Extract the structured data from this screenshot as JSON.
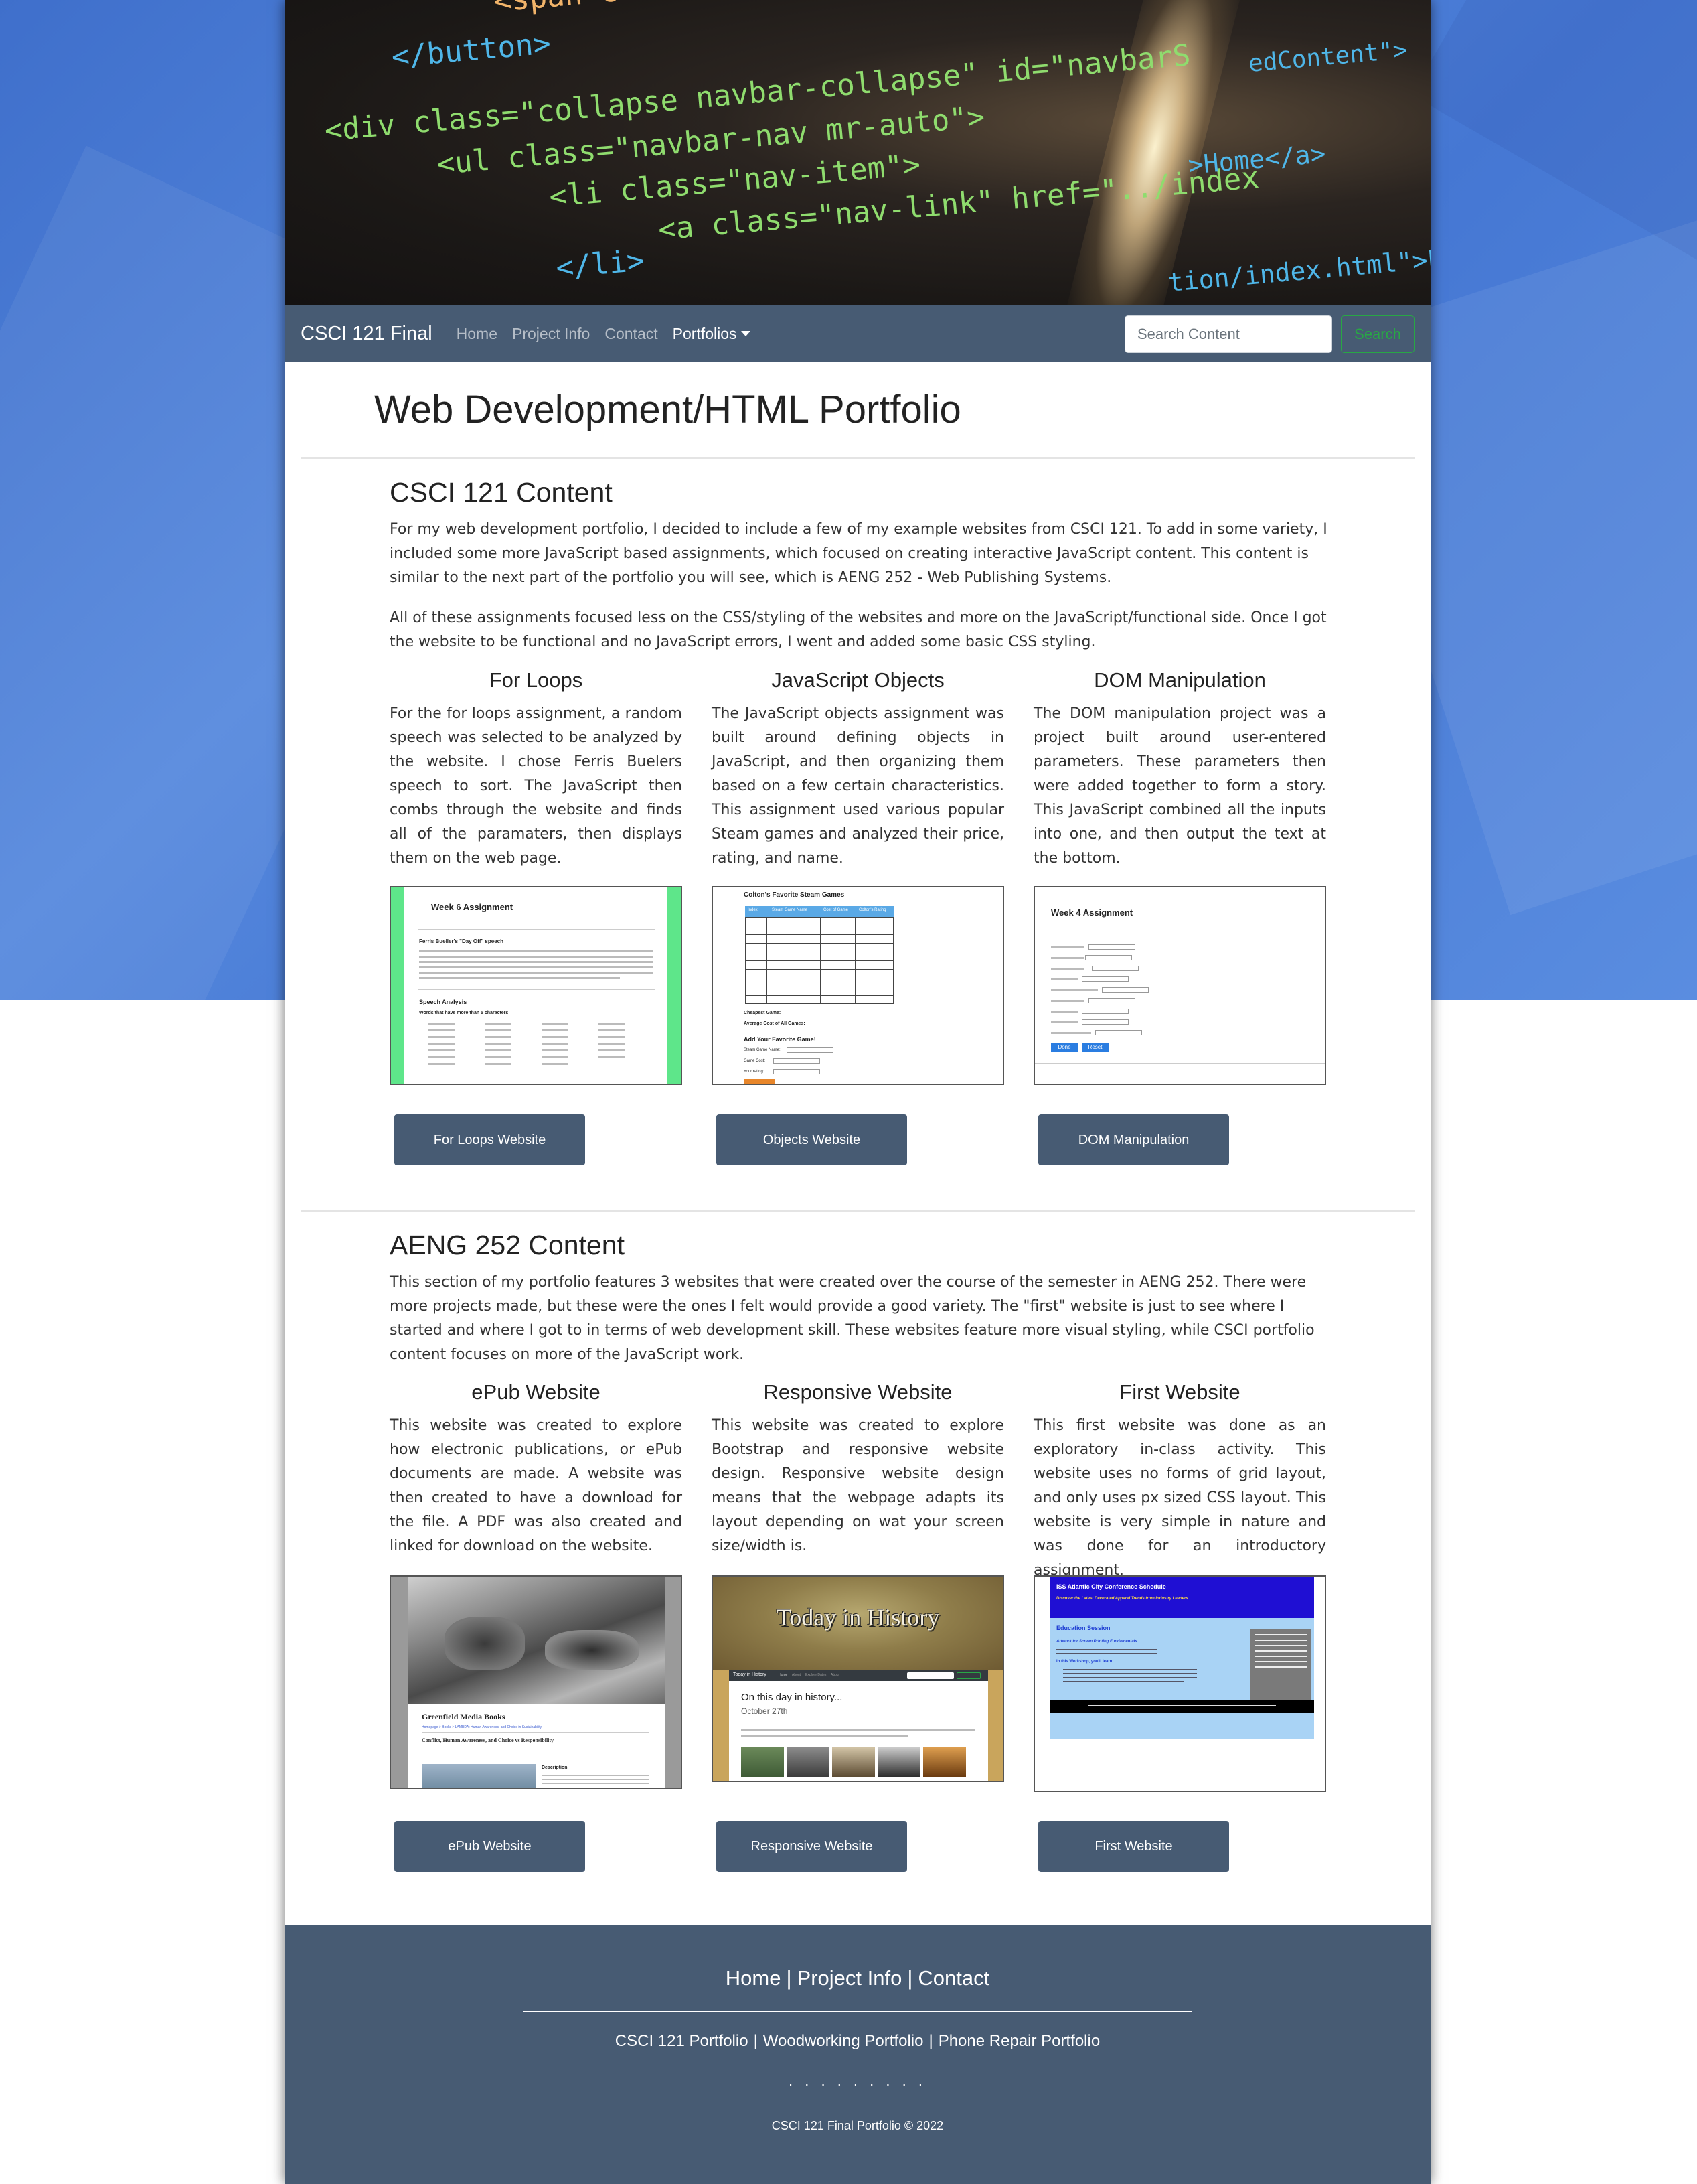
{
  "hero": {
    "code_lines": [
      "  <span class=\"navbar-toggl",
      "</button>",
      "<div class=\"collapse navbar-collapse\" id=\"navbarS",
      "  <ul class=\"navbar-nav mr-auto\">",
      "    <li class=\"nav-item\">",
      "      <a class=\"nav-link\" href=\"../index",
      "    </li>",
      "edContent\">",
      ">Home</a>",
      "tion/index.html\">Pr"
    ]
  },
  "navbar": {
    "brand": "CSCI 121 Final",
    "links": [
      "Home",
      "Project Info",
      "Contact"
    ],
    "dropdown": "Portfolios",
    "search_placeholder": "Search Content",
    "search_button": "Search"
  },
  "main": {
    "title": "Web Development/HTML Portfolio",
    "csci": {
      "heading": "CSCI 121 Content",
      "para1": "For my web development portfolio, I decided to include a few of my example websites from CSCI 121. To add in some variety, I included some more JavaScript based assignments, which focused on creating interactive JavaScript content. This content is similar to the next part of the portfolio you will see, which is AENG 252 - Web Publishing Systems.",
      "para2": "All of these assignments focused less on the CSS/styling of the websites and more on the JavaScript/functional side. Once I got the website to be functional and no JavaScript errors, I went and added some basic CSS styling.",
      "cards": [
        {
          "title": "For Loops",
          "text": "For the for loops assignment, a random speech was selected to be analyzed by the website. I chose Ferris Buelers speech to sort. The JavaScript then combs through the website and finds all of the paramaters, then displays them on the web page.",
          "button": "For Loops Website"
        },
        {
          "title": "JavaScript Objects",
          "text": "The JavaScript objects assignment was built around defining objects in JavaScript, and then organizing them based on a few certain characteristics. This assignment used various popular Steam games and analyzed their price, rating, and name.",
          "button": "Objects Website"
        },
        {
          "title": "DOM Manipulation",
          "text": "The DOM manipulation project was a project built around user-entered parameters. These parameters then were added together to form a story. This JavaScript combined all the inputs into one, and then output the text at the bottom.",
          "button": "DOM Manipulation"
        }
      ],
      "thumbs": {
        "for_loops": {
          "title": "Week 6 Assignment",
          "subtitle": "Ferris Bueller's \"Day Off\" speech",
          "section": "Speech Analysis",
          "note": "Words that have more than 5 characters"
        },
        "objects": {
          "title": "Colton's Favorite Steam Games",
          "headers": [
            "Index",
            "Steam Game Name",
            "Cost of Game",
            "Colton's Rating"
          ],
          "rows": 10,
          "cheapest": "Cheapest Game:",
          "average": "Average Cost of All Games:",
          "add_title": "Add Your Favorite Game!",
          "fields": [
            "Steam Game Name:",
            "Game Cost:",
            "Your rating:"
          ]
        },
        "dom": {
          "title": "Week 4 Assignment",
          "done": "Done",
          "reset": "Reset"
        }
      }
    },
    "aeng": {
      "heading": "AENG 252 Content",
      "para": "This section of my portfolio features 3 websites that were created over the course of the semester in AENG 252. There were more projects made, but these were the ones I felt would provide a good variety. The \"first\" website is just to see where I started and where I got to in terms of web development skill. These websites feature more visual styling, while CSCI portfolio content focuses on more of the JavaScript work.",
      "cards": [
        {
          "title": "ePub Website",
          "text": "This website was created to explore how electronic publications, or ePub documents are made. A website was then created to have a download for the file. A PDF was also created and linked for download on the website.",
          "button": "ePub Website"
        },
        {
          "title": "Responsive Website",
          "text": "This website was created to explore Bootstrap and responsive website design. Responsive website design means that the webpage adapts its layout depending on wat your screen size/width is.",
          "button": "Responsive Website"
        },
        {
          "title": "First Website",
          "text": "This first website was done as an exploratory in-class activity. This website uses no forms of grid layout, and only uses px sized CSS layout. This website is very simple in nature and was done for an introductory assignment.",
          "button": "First Website"
        }
      ],
      "thumbs": {
        "epub": {
          "title": "Greenfield Media Books",
          "breadcrumb": "Homepage > Books > LAMBDA: Human Awareness, and Choice in Sustainability",
          "book_title": "Conflict, Human Awareness, and Choice vs Responsibility",
          "desc_label": "Description"
        },
        "responsive": {
          "banner": "Today in History",
          "nav_brand": "Today in History",
          "nav_items": [
            "Home",
            "About",
            "Explore Dates",
            "About"
          ],
          "heading": "On this day in history...",
          "date": "October 27th"
        },
        "first": {
          "title": "ISS Atlantic City Conference Schedule",
          "subtitle": "Discover the Latest Decorated Apparel Trends from Industry Leaders",
          "section": "Education Session",
          "session": "Artwork for Screen Printing Fundamentals",
          "workshop": "In this Workshop, you'll learn:"
        }
      }
    }
  },
  "footer": {
    "links1": [
      "Home",
      "Project Info",
      "Contact"
    ],
    "links2": [
      "CSCI 121 Portfolio",
      "Woodworking Portfolio",
      "Phone Repair Portfolio"
    ],
    "dots": ". . . . . . . . .",
    "copyright": "CSCI 121 Final Portfolio © 2022"
  },
  "colors": {
    "navbar": "#475b73",
    "background_blue": "#4a7ad4",
    "search_green": "#28a745"
  }
}
